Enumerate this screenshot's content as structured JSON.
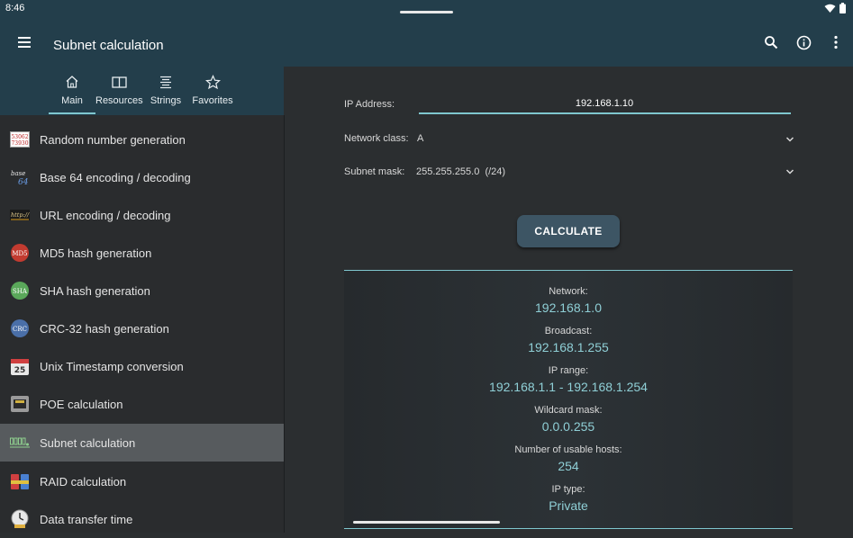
{
  "status": {
    "time": "8:46"
  },
  "app": {
    "title": "Subnet calculation"
  },
  "tabs": [
    {
      "label": "Main",
      "icon": "home-icon",
      "selected": true
    },
    {
      "label": "Resources",
      "icon": "book-icon",
      "selected": false
    },
    {
      "label": "Strings",
      "icon": "text-align-icon",
      "selected": false
    },
    {
      "label": "Favorites",
      "icon": "star-icon",
      "selected": false
    }
  ],
  "sidebar": {
    "items": [
      {
        "label": "Random number generation",
        "icon": "random-number-icon"
      },
      {
        "label": "Base 64 encoding / decoding",
        "icon": "base64-icon",
        "icon_text_top": "base",
        "icon_text_bottom": "64"
      },
      {
        "label": "URL encoding / decoding",
        "icon": "url-icon",
        "icon_text": "http://"
      },
      {
        "label": "MD5 hash generation",
        "icon": "md5-icon",
        "icon_text": "MD5"
      },
      {
        "label": "SHA hash generation",
        "icon": "sha-icon",
        "icon_text": "SHA"
      },
      {
        "label": "CRC-32 hash generation",
        "icon": "crc-icon",
        "icon_text": "CRC"
      },
      {
        "label": "Unix Timestamp conversion",
        "icon": "calendar-icon",
        "icon_text": "25"
      },
      {
        "label": "POE calculation",
        "icon": "ethernet-port-icon"
      },
      {
        "label": "Subnet calculation",
        "icon": "subnet-icon",
        "active": true
      },
      {
        "label": "RAID calculation",
        "icon": "raid-icon"
      },
      {
        "label": "Data transfer time",
        "icon": "clock-icon"
      }
    ],
    "random_icon_text_top": "53062",
    "random_icon_text_bottom": "73930"
  },
  "form": {
    "ip_label": "IP Address:",
    "ip_value": "192.168.1.10",
    "class_label": "Network class:",
    "class_value": "A",
    "mask_label": "Subnet mask:",
    "mask_value": "255.255.255.0  (/24)",
    "calculate_label": "CALCULATE"
  },
  "results": [
    {
      "label": "Network:",
      "value": "192.168.1.0"
    },
    {
      "label": "Broadcast:",
      "value": "192.168.1.255"
    },
    {
      "label": "IP range:",
      "value": "192.168.1.1 - 192.168.1.254"
    },
    {
      "label": "Wildcard mask:",
      "value": "0.0.0.255"
    },
    {
      "label": "Number of usable hosts:",
      "value": "254"
    },
    {
      "label": "IP type:",
      "value": "Private"
    }
  ],
  "colors": {
    "appbar": "#233e4b",
    "accent": "#7fc7cf",
    "result_value": "#8fcfd6"
  }
}
